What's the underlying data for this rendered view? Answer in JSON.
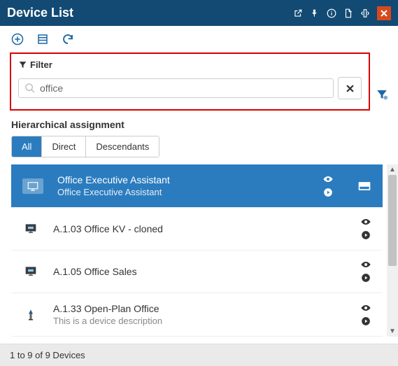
{
  "header": {
    "title": "Device List",
    "icons": {
      "external": "external-link-icon",
      "pin": "pin-icon",
      "info": "info-icon",
      "pdf": "pdf-icon",
      "dock": "dock-icon",
      "close": "close-icon"
    }
  },
  "toolbar": {
    "add": "add-icon",
    "list": "list-view-icon",
    "refresh": "refresh-icon"
  },
  "filter": {
    "label": "Filter",
    "value": "office",
    "placeholder": "",
    "clear": "✖"
  },
  "hierarchical": {
    "title": "Hierarchical assignment",
    "tabs": [
      {
        "label": "All",
        "active": true
      },
      {
        "label": "Direct",
        "active": false
      },
      {
        "label": "Descendants",
        "active": false
      }
    ]
  },
  "devices": [
    {
      "title": "Office Executive Assistant",
      "subtitle": "Office Executive Assistant",
      "selected": true,
      "hasExtra": true
    },
    {
      "title": "A.1.03 Office KV - cloned",
      "subtitle": "",
      "selected": false,
      "hasExtra": false
    },
    {
      "title": "A.1.05 Office Sales",
      "subtitle": "",
      "selected": false,
      "hasExtra": false
    },
    {
      "title": "A.1.33 Open-Plan Office",
      "subtitle": "This is a device description",
      "selected": false,
      "hasExtra": false
    }
  ],
  "footer": {
    "status": "1 to 9 of 9 Devices"
  }
}
